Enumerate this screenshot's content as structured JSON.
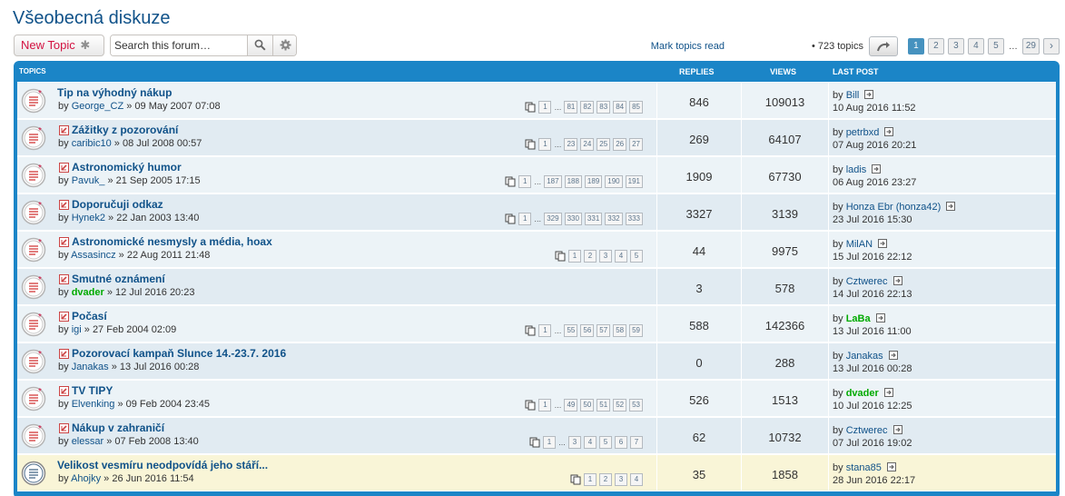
{
  "forum": {
    "title": "Všeobecná diskuze",
    "new_topic_label": "New Topic",
    "new_topic_icon": "asterisk-icon",
    "search_placeholder": "Search this forum…",
    "mark_read_label": "Mark topics read",
    "topic_count": "• 723 topics",
    "pages": [
      "1",
      "2",
      "3",
      "4",
      "5",
      "…",
      "29"
    ],
    "current_page": "1",
    "next_symbol": "›"
  },
  "header": {
    "topics": "Topics",
    "replies": "Replies",
    "views": "Views",
    "last_post": "Last post"
  },
  "colors": {
    "link": "#105289",
    "header_bg": "#1b85c7",
    "row_bg1": "#ecf3f7",
    "row_bg2": "#e1ebf2",
    "sticky_bg": "#f9f5d7",
    "green_user": "#00aa00",
    "new_topic_red": "#d31141"
  },
  "topics": [
    {
      "title": "Tip na výhodný nákup",
      "has_new": false,
      "by": "by",
      "author": "George_CZ",
      "author_green": false,
      "date": "» 09 May 2007 07:08",
      "pages": [
        "1",
        "…",
        "81",
        "82",
        "83",
        "84",
        "85"
      ],
      "replies": "846",
      "views": "109013",
      "lp_by": "by",
      "lp_author": "Bill",
      "lp_author_green": false,
      "lp_date": "10 Aug 2016 11:52",
      "row_class": "bg1"
    },
    {
      "title": "Zážitky z pozorování",
      "has_new": true,
      "by": "by",
      "author": "caribic10",
      "author_green": false,
      "date": "» 08 Jul 2008 00:57",
      "pages": [
        "1",
        "…",
        "23",
        "24",
        "25",
        "26",
        "27"
      ],
      "replies": "269",
      "views": "64107",
      "lp_by": "by",
      "lp_author": "petrbxd",
      "lp_author_green": false,
      "lp_date": "07 Aug 2016 20:21",
      "row_class": "bg2"
    },
    {
      "title": "Astronomický humor",
      "has_new": true,
      "by": "by",
      "author": "Pavuk_",
      "author_green": false,
      "date": "» 21 Sep 2005 17:15",
      "pages": [
        "1",
        "…",
        "187",
        "188",
        "189",
        "190",
        "191"
      ],
      "replies": "1909",
      "views": "67730",
      "lp_by": "by",
      "lp_author": "ladis",
      "lp_author_green": false,
      "lp_date": "06 Aug 2016 23:27",
      "row_class": "bg1"
    },
    {
      "title": "Doporučuji odkaz",
      "has_new": true,
      "by": "by",
      "author": "Hynek2",
      "author_green": false,
      "date": "» 22 Jan 2003 13:40",
      "pages": [
        "1",
        "…",
        "329",
        "330",
        "331",
        "332",
        "333"
      ],
      "replies": "3327",
      "views": "3139",
      "lp_by": "by",
      "lp_author": "Honza Ebr (honza42)",
      "lp_author_green": false,
      "lp_date": "23 Jul 2016 15:30",
      "row_class": "bg2"
    },
    {
      "title": "Astronomické nesmysly a média, hoax",
      "has_new": true,
      "by": "by",
      "author": "Assasincz",
      "author_green": false,
      "date": "» 22 Aug 2011 21:48",
      "pages": [
        "1",
        "2",
        "3",
        "4",
        "5"
      ],
      "replies": "44",
      "views": "9975",
      "lp_by": "by",
      "lp_author": "MilAN",
      "lp_author_green": false,
      "lp_date": "15 Jul 2016 22:12",
      "row_class": "bg1"
    },
    {
      "title": "Smutné oznámení",
      "has_new": true,
      "by": "by",
      "author": "dvader",
      "author_green": true,
      "date": "» 12 Jul 2016 20:23",
      "pages": [],
      "replies": "3",
      "views": "578",
      "lp_by": "by",
      "lp_author": "Cztwerec",
      "lp_author_green": false,
      "lp_date": "14 Jul 2016 22:13",
      "row_class": "bg2"
    },
    {
      "title": "Počasí",
      "has_new": true,
      "by": "by",
      "author": "igi",
      "author_green": false,
      "date": "» 27 Feb 2004 02:09",
      "pages": [
        "1",
        "…",
        "55",
        "56",
        "57",
        "58",
        "59"
      ],
      "replies": "588",
      "views": "142366",
      "lp_by": "by",
      "lp_author": "LaBa",
      "lp_author_green": true,
      "lp_date": "13 Jul 2016 11:00",
      "row_class": "bg1"
    },
    {
      "title": "Pozorovací kampaň Slunce 14.-23.7. 2016",
      "has_new": true,
      "by": "by",
      "author": "Janakas",
      "author_green": false,
      "date": "» 13 Jul 2016 00:28",
      "pages": [],
      "replies": "0",
      "views": "288",
      "lp_by": "by",
      "lp_author": "Janakas",
      "lp_author_green": false,
      "lp_date": "13 Jul 2016 00:28",
      "row_class": "bg2"
    },
    {
      "title": "TV TIPY",
      "has_new": true,
      "by": "by",
      "author": "Elvenking",
      "author_green": false,
      "date": "» 09 Feb 2004 23:45",
      "pages": [
        "1",
        "…",
        "49",
        "50",
        "51",
        "52",
        "53"
      ],
      "replies": "526",
      "views": "1513",
      "lp_by": "by",
      "lp_author": "dvader",
      "lp_author_green": true,
      "lp_date": "10 Jul 2016 12:25",
      "row_class": "bg1"
    },
    {
      "title": "Nákup v zahraničí",
      "has_new": true,
      "by": "by",
      "author": "elessar",
      "author_green": false,
      "date": "» 07 Feb 2008 13:40",
      "pages": [
        "1",
        "…",
        "3",
        "4",
        "5",
        "6",
        "7"
      ],
      "replies": "62",
      "views": "10732",
      "lp_by": "by",
      "lp_author": "Cztwerec",
      "lp_author_green": false,
      "lp_date": "07 Jul 2016 19:02",
      "row_class": "bg2"
    },
    {
      "title": "Velikost vesmíru neodpovídá jeho stáří...",
      "has_new": false,
      "by": "by",
      "author": "Ahojky",
      "author_green": false,
      "date": "» 26 Jun 2016 11:54",
      "pages": [
        "1",
        "2",
        "3",
        "4"
      ],
      "replies": "35",
      "views": "1858",
      "lp_by": "by",
      "lp_author": "stana85",
      "lp_author_green": false,
      "lp_date": "28 Jun 2016 22:17",
      "row_class": "sticky"
    }
  ]
}
